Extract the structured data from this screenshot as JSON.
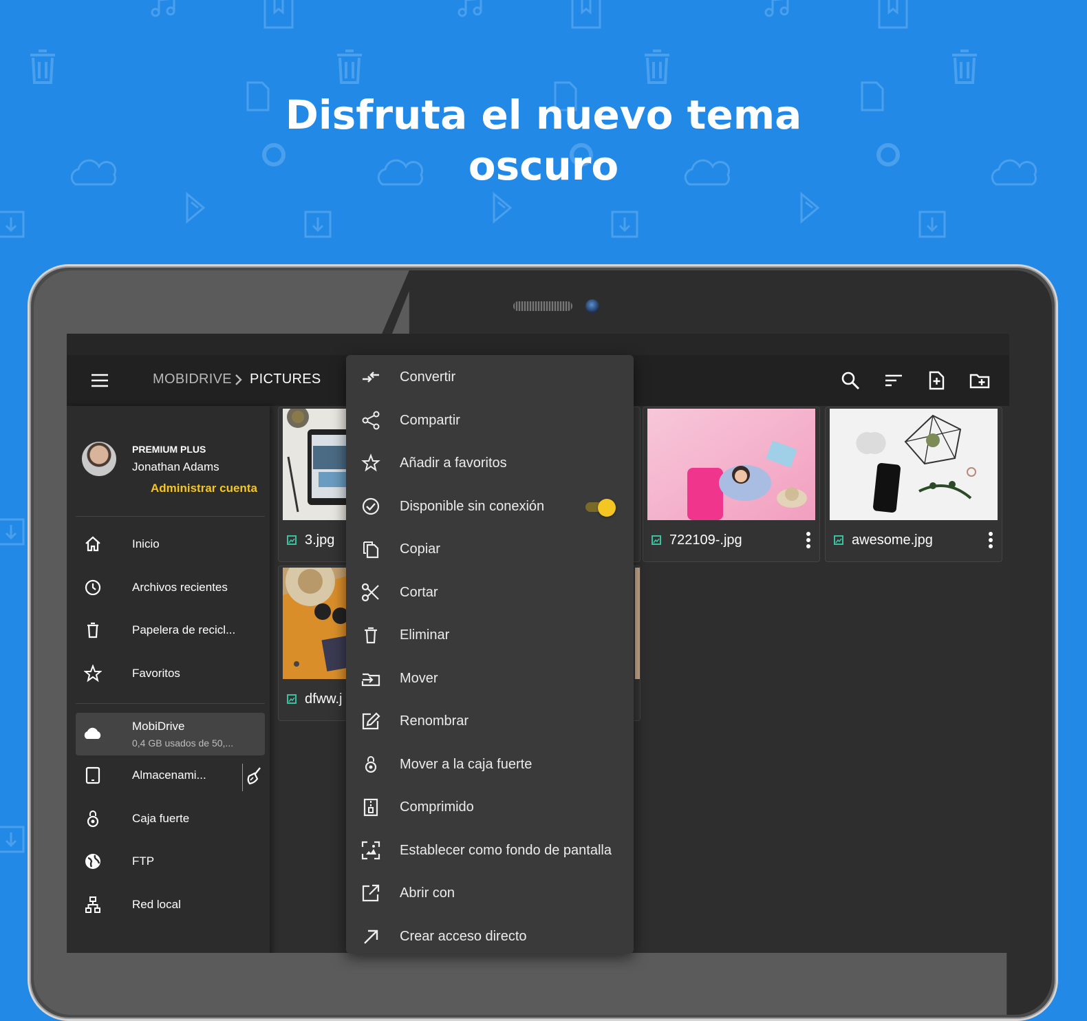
{
  "headline": {
    "line1": "Disfruta el nuevo tema",
    "line2": "oscuro"
  },
  "colors": {
    "background": "#2389e6",
    "accent": "#f3c623",
    "appbar": "#212121",
    "surface": "#2e2e2e"
  },
  "toolbar": {
    "breadcrumb": [
      "MOBIDRIVE",
      "PICTURES"
    ],
    "icons": [
      "menu-icon",
      "search-icon",
      "sort-icon",
      "new-file-icon",
      "new-folder-icon"
    ]
  },
  "drawer": {
    "account": {
      "plan": "PREMIUM PLUS",
      "name": "Jonathan Adams",
      "manage_label": "Administrar cuenta"
    },
    "items": [
      {
        "label": "Inicio",
        "icon": "home-icon"
      },
      {
        "label": "Archivos recientes",
        "icon": "clock-icon"
      },
      {
        "label": "Papelera de recicl...",
        "icon": "trash-icon"
      },
      {
        "label": "Favoritos",
        "icon": "star-icon"
      }
    ],
    "storage": [
      {
        "label": "MobiDrive",
        "sub": "0,4 GB usados de 50,...",
        "icon": "cloud-icon",
        "selected": true
      },
      {
        "label": "Almacenami...",
        "icon": "tablet-icon"
      },
      {
        "label": "Caja fuerte",
        "icon": "vault-icon"
      },
      {
        "label": "FTP",
        "icon": "globe-icon"
      },
      {
        "label": "Red local",
        "icon": "network-icon"
      }
    ]
  },
  "files": [
    {
      "name": "3.jpg"
    },
    {
      "name": "722109-.jpg"
    },
    {
      "name": "awesome.jpg"
    },
    {
      "name": "dfww.j"
    }
  ],
  "context_menu": {
    "items": [
      {
        "label": "Convertir",
        "icon": "convert-icon"
      },
      {
        "label": "Compartir",
        "icon": "share-icon"
      },
      {
        "label": "Añadir a favoritos",
        "icon": "star-icon"
      },
      {
        "label": "Disponible sin conexión",
        "icon": "offline-check-icon",
        "toggle_on": true
      },
      {
        "label": "Copiar",
        "icon": "copy-icon"
      },
      {
        "label": "Cortar",
        "icon": "scissors-icon"
      },
      {
        "label": "Eliminar",
        "icon": "trash-icon"
      },
      {
        "label": "Mover",
        "icon": "move-icon"
      },
      {
        "label": "Renombrar",
        "icon": "rename-icon"
      },
      {
        "label": "Mover a la caja fuerte",
        "icon": "vault-icon"
      },
      {
        "label": "Comprimido",
        "icon": "zip-icon"
      },
      {
        "label": "Establecer como fondo de pantalla",
        "icon": "wallpaper-icon"
      },
      {
        "label": "Abrir con",
        "icon": "open-with-icon"
      },
      {
        "label": "Crear acceso directo",
        "icon": "shortcut-icon"
      }
    ]
  }
}
